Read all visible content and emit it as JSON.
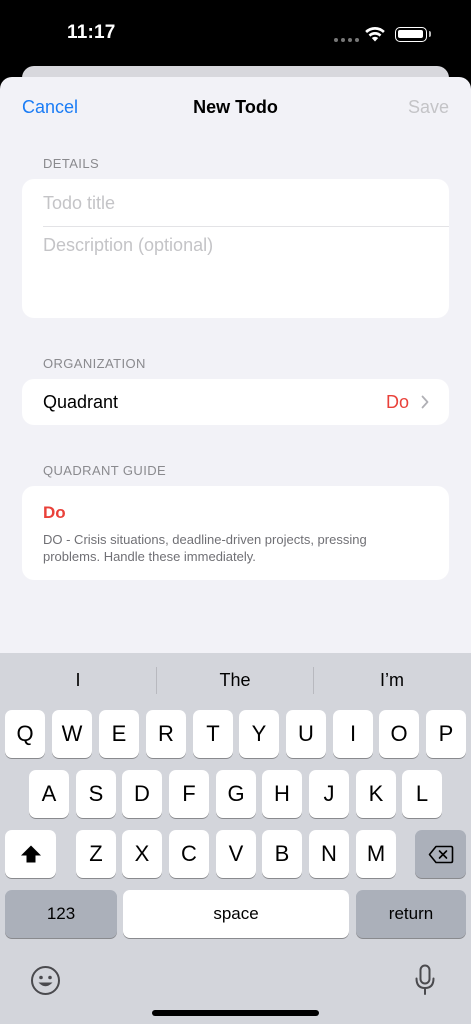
{
  "status_bar": {
    "time": "11:17"
  },
  "nav": {
    "cancel_label": "Cancel",
    "title": "New Todo",
    "save_label": "Save"
  },
  "details": {
    "header": "DETAILS",
    "title_placeholder": "Todo title",
    "description_placeholder": "Description (optional)"
  },
  "organization": {
    "header": "ORGANIZATION",
    "quadrant_label": "Quadrant",
    "quadrant_value": "Do"
  },
  "guide": {
    "header": "QUADRANT GUIDE",
    "title": "Do",
    "description": "DO - Crisis situations, deadline-driven projects, pressing problems. Handle these immediately."
  },
  "keyboard": {
    "suggestions": [
      "I",
      "The",
      "I’m"
    ],
    "row1": [
      "Q",
      "W",
      "E",
      "R",
      "T",
      "Y",
      "U",
      "I",
      "O",
      "P"
    ],
    "row2": [
      "A",
      "S",
      "D",
      "F",
      "G",
      "H",
      "J",
      "K",
      "L"
    ],
    "row3": [
      "Z",
      "X",
      "C",
      "V",
      "B",
      "N",
      "M"
    ],
    "numbers_label": "123",
    "space_label": "space",
    "return_label": "return"
  },
  "colors": {
    "accent": "#1a7cf5",
    "destructive": "#e9413a",
    "background": "#f2f2f7"
  }
}
